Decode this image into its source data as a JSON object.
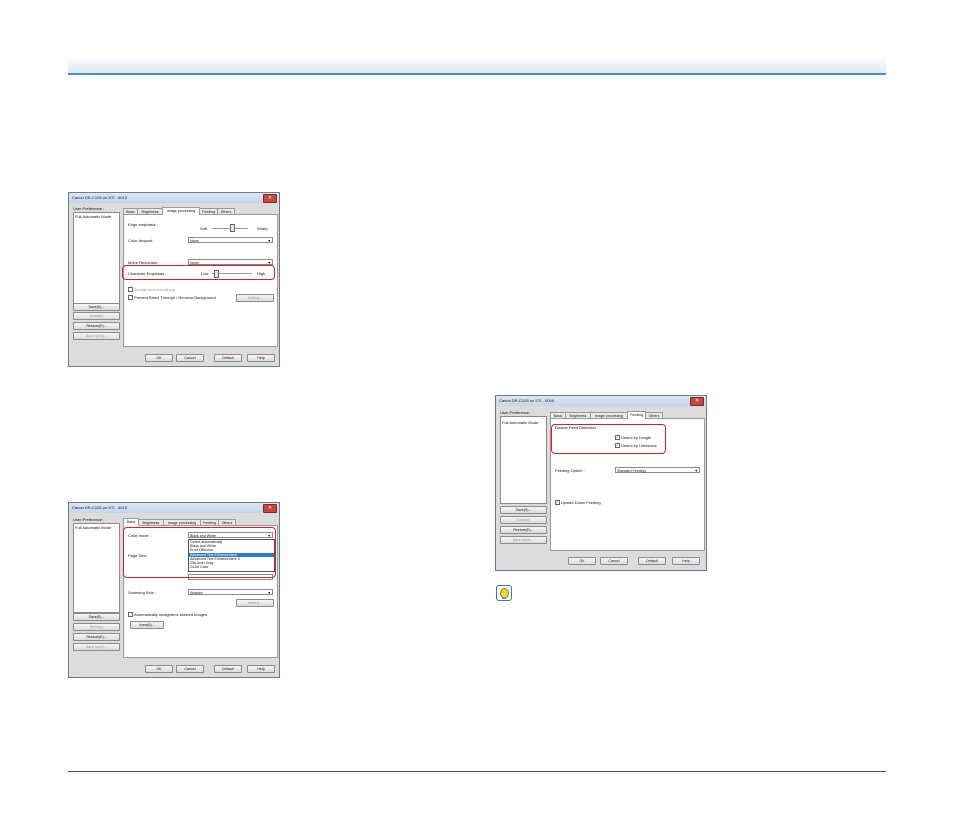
{
  "dialog1": {
    "title": "Canon DR-C125 on STI - 0013",
    "user_pref": "User Preference :",
    "list_item": "Full Automatic Mode",
    "side_buttons": [
      "Save(S)...",
      "Delete(I)",
      "Restore(E)...",
      "Back Up(K)..."
    ],
    "tabs": [
      "Basic",
      "Brightness",
      "Image processing",
      "Feeding",
      "Others"
    ],
    "active_tab": "Image processing",
    "edge_label": "Edge emphasis :",
    "edge_soft": "Soft",
    "edge_sharp": "Sharp",
    "dropout_label": "Color dropout :",
    "dropout_value": "None",
    "moire_label": "Moire Reduction :",
    "moire_value": "None",
    "char_label": "Character Emphasis :",
    "char_low": "Low",
    "char_high": "High",
    "bg_smoothing": "Background smoothing",
    "bleed": "Prevent Bleed Through / Remove Background",
    "setting_btn": "Setting...",
    "bottom_buttons": [
      "OK",
      "Cancel",
      "Default",
      "Help"
    ]
  },
  "dialog2": {
    "title": "Canon DR-C125 on STI - 0013",
    "user_pref": "User Preference :",
    "list_item": "Full Automatic Mode",
    "side_buttons": [
      "Save(S)...",
      "Delete(I)",
      "Restore(E)...",
      "Back Up(K)..."
    ],
    "tabs": [
      "Basic",
      "Brightness",
      "Image processing",
      "Feeding",
      "Others"
    ],
    "color_mode_label": "Color mode :",
    "color_mode_value": "Black and White",
    "color_options": [
      "Detect automatically",
      "Black and White",
      "Error Diffusion",
      "Advanced Text Enhancement",
      "Advanced Text Enhancement II",
      "256-level Gray",
      "24-bit Color"
    ],
    "selected_option": "Advanced Text Enhancement",
    "page_size_label": "Page Size :",
    "scanning_side_label": "Scanning Side :",
    "scanning_side_value": "Simplex",
    "setting_btn": "Setting...",
    "auto_straighten": "Automatically straightens skewed images",
    "area_btn": "Area(A)...",
    "bottom_buttons": [
      "OK",
      "Cancel",
      "Default",
      "Help"
    ]
  },
  "dialog3": {
    "title": "Canon DR-C125 on STI - 0009",
    "user_pref": "User Preference :",
    "list_item": "Full Automatic Mode",
    "side_buttons": [
      "Save(S)...",
      "Delete(I)",
      "Restore(E)...",
      "Back Up(K)..."
    ],
    "tabs": [
      "Basic",
      "Brightness",
      "Image processing",
      "Feeding",
      "Others"
    ],
    "dfd_label": "Double Feed Detection :",
    "detect_length": "Detect by Length",
    "detect_ultrasonic": "Detect by Ultrasonic",
    "feeding_option_label": "Feeding Option :",
    "feeding_option_value": "Standard Feeding",
    "upside_down": "Upside-Down Feeding",
    "bottom_buttons": [
      "OK",
      "Cancel",
      "Default",
      "Help"
    ]
  }
}
